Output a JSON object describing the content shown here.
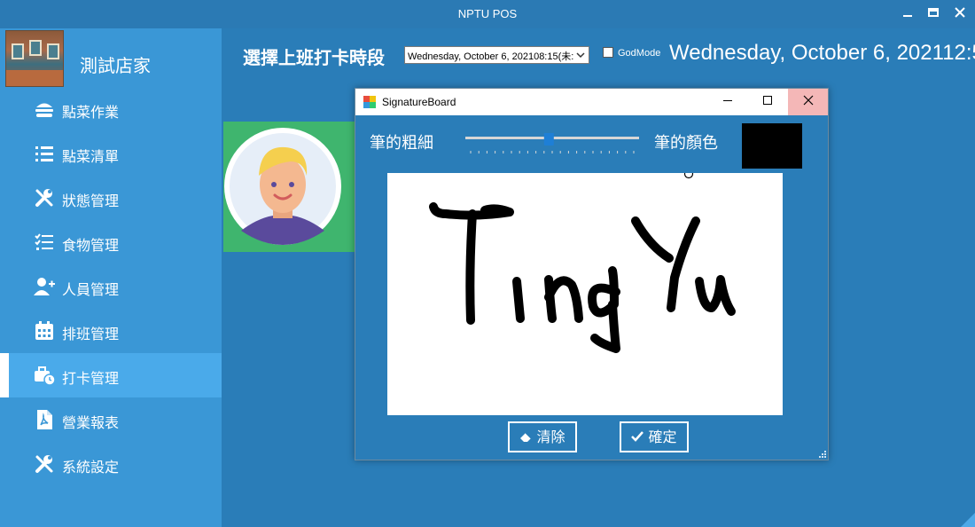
{
  "window": {
    "title": "NPTU POS",
    "controls": [
      "minimize",
      "maximize",
      "close"
    ]
  },
  "sidebar": {
    "store_name": "測試店家",
    "items": [
      {
        "label": "點菜作業",
        "icon": "hamburger-icon",
        "active": false
      },
      {
        "label": "點菜清單",
        "icon": "list-icon",
        "active": false
      },
      {
        "label": "狀態管理",
        "icon": "tools-icon",
        "active": false
      },
      {
        "label": "食物管理",
        "icon": "checklist-icon",
        "active": false
      },
      {
        "label": "人員管理",
        "icon": "add-user-icon",
        "active": false
      },
      {
        "label": "排班管理",
        "icon": "calendar-icon",
        "active": false
      },
      {
        "label": "打卡管理",
        "icon": "briefcase-clock-icon",
        "active": true
      },
      {
        "label": "營業報表",
        "icon": "pdf-file-icon",
        "active": false
      },
      {
        "label": "系統設定",
        "icon": "tools-icon",
        "active": false
      }
    ]
  },
  "main": {
    "shift_label": "選擇上班打卡時段",
    "shift_select_value": "Wednesday, October 6, 202108:15(未:",
    "godmode_label": "GodMode",
    "godmode_checked": false,
    "clock": "Wednesday, October 6, 202112:5"
  },
  "dialog": {
    "title": "SignatureBoard",
    "pen_width_label": "筆的粗細",
    "pen_width_level": 0.48,
    "pen_color_label": "筆的顏色",
    "pen_color": "#000000",
    "clear_button": "清除",
    "confirm_button": "確定"
  },
  "colors": {
    "background": "#2a7db8",
    "sidebar": "#3a97d6",
    "active": "#4aaaea",
    "card": "#3fb56e"
  }
}
